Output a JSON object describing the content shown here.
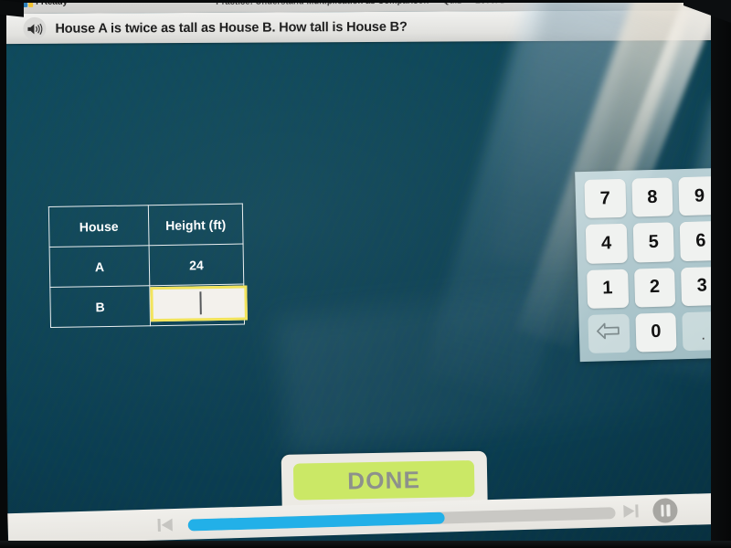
{
  "app": {
    "brand": "i-Ready",
    "brand_colors": [
      "#2c7fb8",
      "#7fbf3f",
      "#f2c230",
      "#2c7fb8"
    ],
    "lesson_title": "Practice: Understand Multiplication as Comparison — Quiz — Level D",
    "close_label": "×"
  },
  "question": {
    "speaker_icon": "speaker-audio-icon",
    "text": "House A is twice as tall as House B. How tall is House B?"
  },
  "table": {
    "headers": [
      "House",
      "Height (ft)"
    ],
    "rows": [
      {
        "house": "A",
        "height": "24",
        "is_input": false
      },
      {
        "house": "B",
        "height": "",
        "is_input": true
      }
    ],
    "input": {
      "value": "",
      "placeholder": "",
      "border_color": "#f2e45c",
      "focused": true
    }
  },
  "keypad": {
    "keys": [
      {
        "label": "7",
        "name": "key-7",
        "style": "normal"
      },
      {
        "label": "8",
        "name": "key-8",
        "style": "normal"
      },
      {
        "label": "9",
        "name": "key-9",
        "style": "normal"
      },
      {
        "label": "4",
        "name": "key-4",
        "style": "normal"
      },
      {
        "label": "5",
        "name": "key-5",
        "style": "normal"
      },
      {
        "label": "6",
        "name": "key-6",
        "style": "normal"
      },
      {
        "label": "1",
        "name": "key-1",
        "style": "normal"
      },
      {
        "label": "2",
        "name": "key-2",
        "style": "normal"
      },
      {
        "label": "3",
        "name": "key-3",
        "style": "normal"
      },
      {
        "label": "",
        "name": "key-backspace",
        "style": "dim"
      },
      {
        "label": "0",
        "name": "key-0",
        "style": "normal"
      },
      {
        "label": ".",
        "name": "key-decimal",
        "style": "dim"
      }
    ]
  },
  "actions": {
    "done_label": "DONE",
    "done_color": "#cbe866"
  },
  "player": {
    "prev_icon": "skip-back-icon",
    "next_icon": "skip-forward-icon",
    "pause_icon": "pause-icon",
    "progress_percent": 60,
    "progress_color": "#22b0e8"
  },
  "colors": {
    "screen_background": "#0c4457",
    "accent": "#22b0e8",
    "highlight": "#f2e45c"
  }
}
